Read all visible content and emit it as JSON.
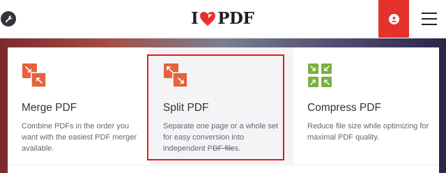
{
  "header": {
    "logo_left": "I",
    "logo_right": "PDF",
    "brand_color": "#e5322d"
  },
  "icons": {
    "tools": "wrench-icon",
    "user": "user-icon",
    "menu": "hamburger-menu-icon",
    "logo_heart": "heart-icon"
  },
  "tools": [
    {
      "title": "Merge PDF",
      "description": "Combine PDFs in the order you want with the easiest PDF merger available.",
      "icon": "merge-icon",
      "color": "#e5623f"
    },
    {
      "title": "Split PDF",
      "description": "Separate one page or a whole set for easy conversion into independent PDF files.",
      "icon": "split-icon",
      "color": "#e5623f",
      "highlighted": true
    },
    {
      "title": "Compress PDF",
      "description": "Reduce file size while optimizing for maximal PDF quality.",
      "icon": "compress-icon",
      "color": "#79b13f"
    }
  ]
}
